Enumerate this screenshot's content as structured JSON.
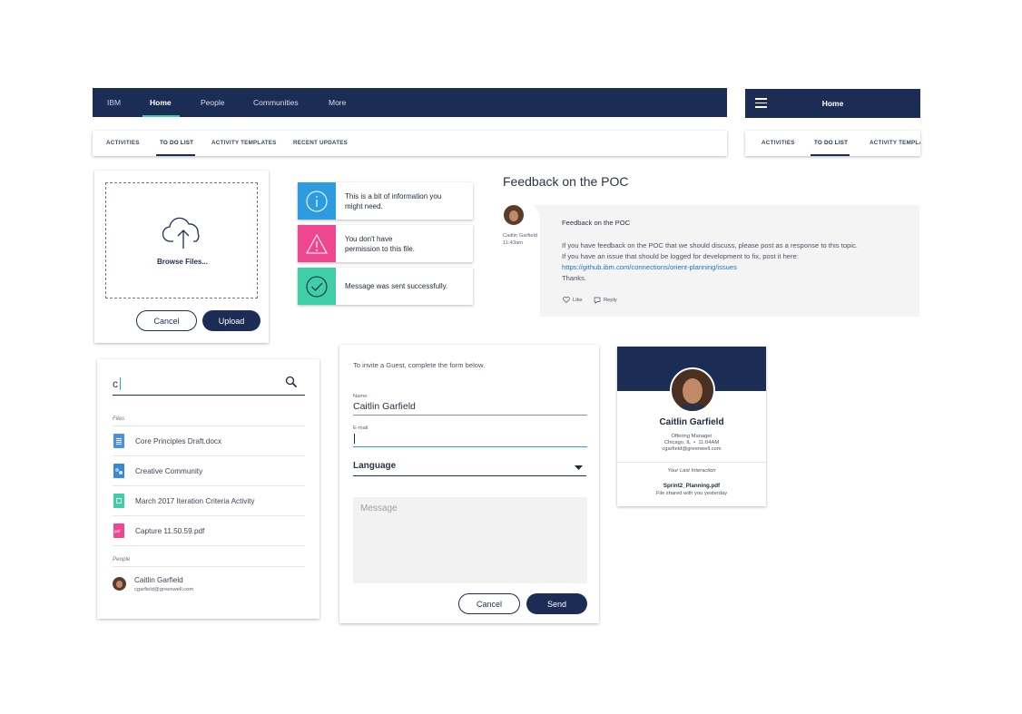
{
  "nav_main": {
    "items": [
      "IBM",
      "Home",
      "People",
      "Communities",
      "More"
    ]
  },
  "nav_mobile": {
    "title": "Home"
  },
  "tabs_main": [
    "ACTIVITIES",
    "TO DO LIST",
    "ACTIVITY TEMPLATES",
    "RECENT UPDATES"
  ],
  "tabs_mobile": [
    "ACTIVITIES",
    "TO DO LIST",
    "ACTIVITY TEMPLA"
  ],
  "upload": {
    "browse_label": "Browse Files...",
    "cancel_label": "Cancel",
    "upload_label": "Upload"
  },
  "notices": [
    {
      "text": "This is a bit of information you might need.",
      "color": "#2d9be0",
      "icon": "info-icon"
    },
    {
      "text": "You don't have permission to this file.",
      "color": "#f0468f",
      "icon": "warning-icon"
    },
    {
      "text": "Message was sent successfully.",
      "color": "#3ecfa8",
      "icon": "checkmark-icon"
    }
  ],
  "feedback": {
    "heading": "Feedback on the POC",
    "author": "Caitlin Garfield",
    "time": "11:43am",
    "title": "Feedback on the POC",
    "line1": "If you have feedback on the POC that we should discuss, please post as a response to this topic.",
    "line2": "If you have an issue that should be logged for development to fix, post it here:",
    "link": "https://github.ibm.com/connections/orient-planning/issues",
    "line3": "Thanks.",
    "like_label": "Like",
    "reply_label": "Reply"
  },
  "search": {
    "value": "c",
    "files_heading": "Files",
    "files": [
      {
        "name": "Core Principles Draft.docx",
        "icon": "doc-file-icon",
        "color": "#4a8fe0"
      },
      {
        "name": "Creative Community",
        "icon": "community-file-icon",
        "color": "#3a86d8"
      },
      {
        "name": "March 2017 Iteration Criteria Activity",
        "icon": "activity-file-icon",
        "color": "#3ecfa8"
      },
      {
        "name": "Capture 11.50.59.pdf",
        "icon": "pdf-file-icon",
        "color": "#f0468f"
      }
    ],
    "people_heading": "People",
    "person_name": "Caitlin Garfield",
    "person_email": "cgarfield@greenwell.com"
  },
  "invite": {
    "intro": "To invite a Guest, complete the form below.",
    "name_label": "Name",
    "name_value": "Caitlin Garfield",
    "email_label": "E-mail",
    "language_label": "Language",
    "message_placeholder": "Message",
    "cancel_label": "Cancel",
    "send_label": "Send"
  },
  "profile": {
    "name": "Caitlin Garfield",
    "title": "Offering Manager",
    "location_time": "Chicago, IL  •  11:04AM",
    "email": "cgarfield@greenwell.com",
    "last_interaction_label": "Your Last Interaction",
    "file_name": "Sprint2_Planning.pdf",
    "file_note": "File shared with you yesterday"
  },
  "colors": {
    "navy": "#1c2d55",
    "link": "#1a73c9",
    "info": "#2d9be0",
    "warning": "#f0468f",
    "success": "#3ecfa8"
  }
}
